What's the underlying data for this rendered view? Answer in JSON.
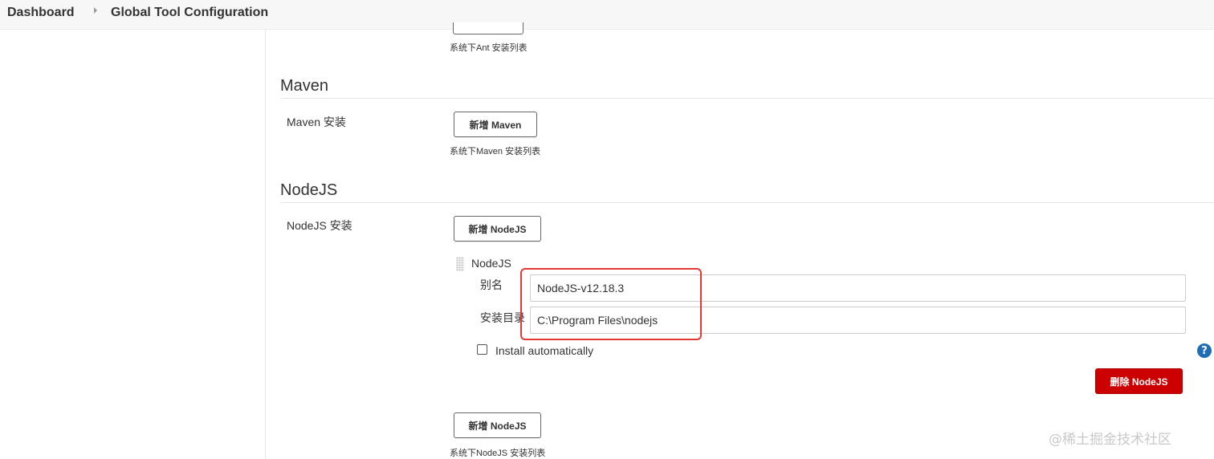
{
  "breadcrumb": {
    "items": [
      "Dashboard",
      "Global Tool Configuration"
    ]
  },
  "ant": {
    "list_desc": "系统下Ant 安装列表"
  },
  "maven": {
    "title": "Maven",
    "field_label": "Maven 安装",
    "add_button": "新增 Maven",
    "list_desc": "系统下Maven 安装列表"
  },
  "nodejs": {
    "title": "NodeJS",
    "field_label": "NodeJS 安装",
    "add_button_top": "新增 NodeJS",
    "installation": {
      "header": "NodeJS",
      "alias_label": "别名",
      "alias_value": "NodeJS-v12.18.3",
      "home_label": "安装目录",
      "home_value": "C:\\Program Files\\nodejs",
      "auto_install_label": "Install automatically",
      "auto_install_checked": false,
      "delete_button": "删除 NodeJS"
    },
    "add_button_bottom": "新增 NodeJS",
    "list_desc": "系统下NodeJS 安装列表"
  },
  "help_icon": "question-icon",
  "watermark": "@稀土掘金技术社区",
  "colors": {
    "danger": "#cc0000",
    "highlight": "#e53935",
    "help": "#1f6db4"
  }
}
